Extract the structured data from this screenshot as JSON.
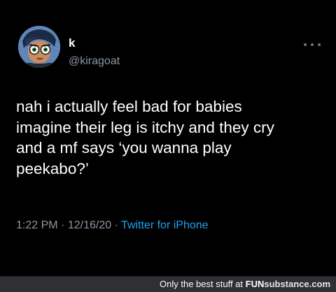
{
  "tweet": {
    "display_name": "k",
    "handle": "@kiragoat",
    "avatar_icon": "cartoon-character-avatar-icon",
    "more_icon": "more-options-icon",
    "lines": [
      "nah i actually feel bad for babies",
      "imagine their leg is itchy and they cry",
      "and a mf says ‘you wanna play",
      "peekabo?’"
    ],
    "time": "1:22 PM",
    "date": "12/16/20",
    "separator": "·",
    "source": "Twitter for iPhone"
  },
  "footer": {
    "prefix": "Only the best stuff at ",
    "brand_fun": "FUN",
    "brand_sub": "substance",
    "brand_tld": ".com"
  },
  "colors": {
    "background": "#000000",
    "muted_text": "#8b98a5",
    "link": "#1da1f2",
    "footer_bg": "#2f3033"
  }
}
